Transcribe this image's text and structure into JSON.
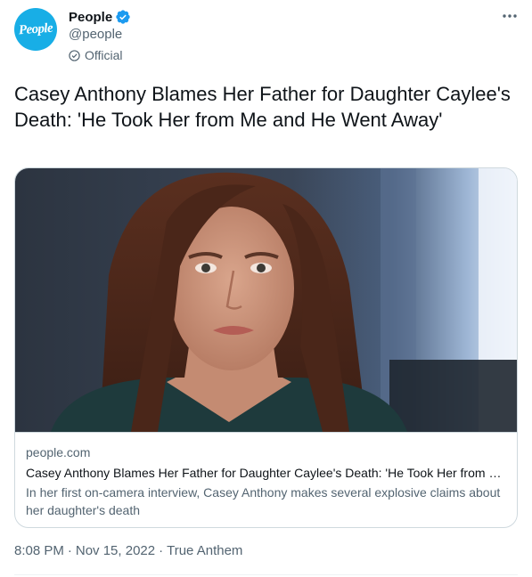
{
  "author": {
    "avatar_text": "People",
    "display_name": "People",
    "handle": "@people",
    "affiliation_label": "Official",
    "verified": true,
    "avatar_color": "#18aee6",
    "verified_color": "#1d9bf0"
  },
  "tweet": {
    "text": "Casey Anthony Blames Her Father for Daughter Caylee's Death: 'He Took Her from Me and He Went Away'"
  },
  "card": {
    "domain": "people.com",
    "title": "Casey Anthony Blames Her Father for Daughter Caylee's Death: 'He Took Her from Me and He Went Away'",
    "description": "In her first on-camera interview, Casey Anthony makes several explosive claims about her daughter's death"
  },
  "meta": {
    "time": "8:08 PM",
    "date": "Nov 15, 2022",
    "source": "True Anthem",
    "separator": "·"
  },
  "icons": {
    "more": "more-horizontal-icon",
    "verified": "verified-badge-icon",
    "official": "official-check-icon"
  }
}
